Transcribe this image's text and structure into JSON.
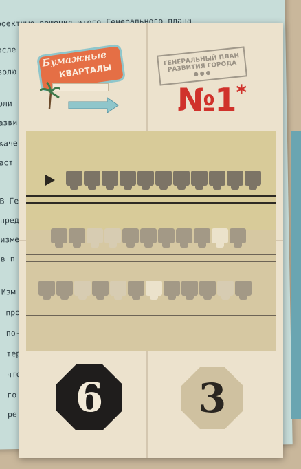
{
  "background_text": [
    "роектные решения этого Генерального плана",
    "осле",
    "золю",
    "оли",
    "азви",
    "каче",
    "аст",
    "В Ге",
    "пред",
    "изме",
    "в п",
    "Изм",
    "про",
    "по-",
    "тер",
    "что",
    "го",
    "ре"
  ],
  "logo": {
    "title": "Бумажные",
    "subtitle": "КВАРТАЛЫ"
  },
  "stamp": {
    "line1": "ГЕНЕРАЛЬНЫЙ ПЛАН",
    "line2": "РАЗВИТИЯ ГОРОДА",
    "dots": "●●●"
  },
  "plan": {
    "number": "№1",
    "star": "*"
  },
  "tokens": {
    "left": "6",
    "right": "3"
  },
  "colors": {
    "plan_number": "#d0322b",
    "card": "#ece2cd",
    "background_doc": "#c7ddd9"
  },
  "rows": {
    "row1": [
      "dark",
      "dark",
      "dark",
      "dark",
      "dark",
      "dark",
      "dark",
      "dark",
      "dark",
      "dark",
      "dark"
    ],
    "row2": [
      "mid",
      "mid",
      "light",
      "light",
      "mid",
      "mid",
      "mid",
      "mid",
      "mid",
      "pale",
      "mid"
    ],
    "row3": [
      "mid",
      "mid",
      "light",
      "mid",
      "light",
      "mid",
      "pale",
      "mid",
      "mid",
      "mid",
      "light",
      "mid"
    ]
  }
}
